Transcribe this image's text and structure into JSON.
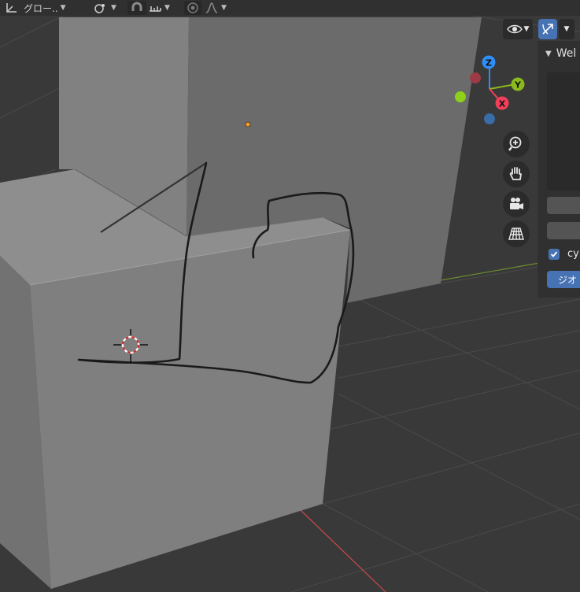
{
  "header": {
    "transform_orientation": "グロー..",
    "snap_icon": "magnet-icon",
    "proportional_icon": "proportional-edit-icon"
  },
  "overlays": {
    "visibility_icon": "eye-icon",
    "gizmo_icon": "gizmo-icon"
  },
  "gizmo": {
    "z": "Z",
    "y": "Y",
    "x": "X",
    "colors": {
      "x": "#f33f5a",
      "y": "#8bbb1a",
      "z": "#2f8ef5",
      "neg_x": "#9c3a45",
      "neg_y": "#8ed119",
      "neg_z": "#3a6ca8"
    }
  },
  "nav_buttons": [
    "zoom-icon",
    "hand-pan-icon",
    "camera-icon",
    "perspective-grid-icon"
  ],
  "npanel": {
    "header_label": "Wel",
    "checkbox_label": "cy",
    "button_label": "ジオ"
  },
  "colors": {
    "viewport_bg": "#393939",
    "accent": "#4772b3",
    "axis_x": "#c94a4a",
    "axis_y": "#6b8d2e"
  }
}
